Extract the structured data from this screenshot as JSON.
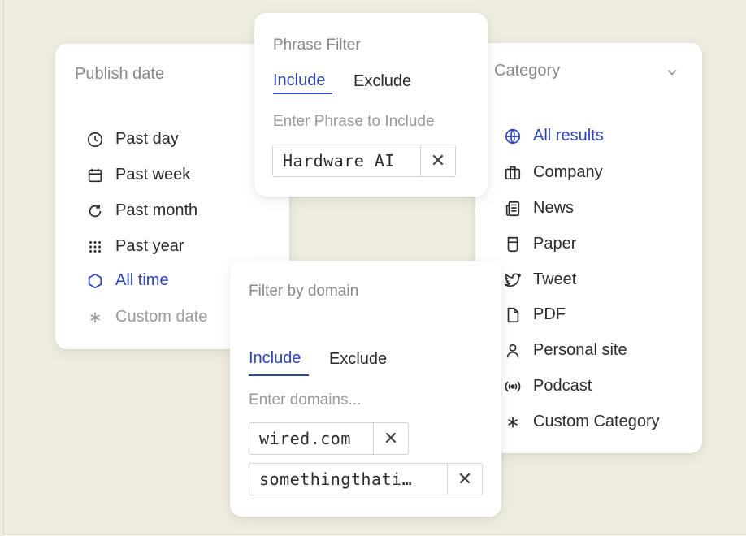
{
  "publish_date": {
    "title": "Publish date",
    "options": [
      {
        "label": "Past day",
        "icon": "clock-icon"
      },
      {
        "label": "Past week",
        "icon": "calendar-icon"
      },
      {
        "label": "Past month",
        "icon": "refresh-icon"
      },
      {
        "label": "Past year",
        "icon": "dots-grid-icon"
      },
      {
        "label": "All time",
        "icon": "hexagon-icon",
        "selected": true
      },
      {
        "label": "Custom date",
        "icon": "asterisk-icon",
        "muted": true
      }
    ]
  },
  "phrase_filter": {
    "title": "Phrase Filter",
    "tabs": [
      {
        "label": "Include",
        "active": true
      },
      {
        "label": "Exclude"
      }
    ],
    "placeholder": "Enter Phrase to Include",
    "chips": [
      {
        "text": "Hardware AI",
        "remove": "✕"
      }
    ]
  },
  "category": {
    "title": "Category",
    "options": [
      {
        "label": "All results",
        "icon": "globe-icon",
        "selected": true
      },
      {
        "label": "Company",
        "icon": "briefcase-icon"
      },
      {
        "label": "News",
        "icon": "newspaper-icon"
      },
      {
        "label": "Paper",
        "icon": "paper-icon"
      },
      {
        "label": "Tweet",
        "icon": "twitter-icon"
      },
      {
        "label": "PDF",
        "icon": "file-icon"
      },
      {
        "label": "Personal site",
        "icon": "person-icon"
      },
      {
        "label": "Podcast",
        "icon": "podcast-icon"
      },
      {
        "label": "Custom Category",
        "icon": "asterisk-icon"
      }
    ]
  },
  "domain_filter": {
    "title": "Filter by domain",
    "tabs": [
      {
        "label": "Include",
        "active": true
      },
      {
        "label": "Exclude"
      }
    ],
    "placeholder": "Enter domains...",
    "chips": [
      {
        "text": "wired.com",
        "remove": "✕"
      },
      {
        "text": "somethingthati…",
        "remove": "✕"
      }
    ]
  },
  "colors": {
    "accent": "#2d44b8",
    "background": "#efede0",
    "muted": "#9a9a9a"
  }
}
